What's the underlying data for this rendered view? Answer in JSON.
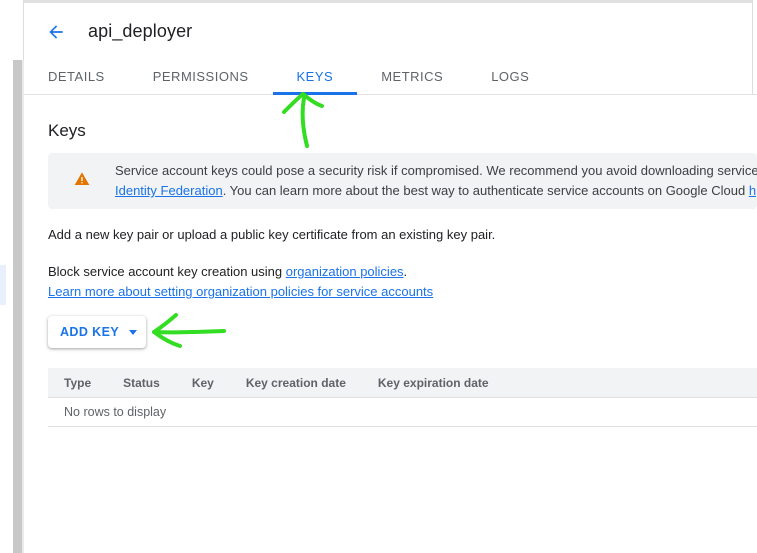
{
  "header": {
    "title": "api_deployer",
    "back_icon": "arrow-back-icon"
  },
  "tabs": [
    {
      "label": "DETAILS",
      "active": false
    },
    {
      "label": "PERMISSIONS",
      "active": false
    },
    {
      "label": "KEYS",
      "active": true
    },
    {
      "label": "METRICS",
      "active": false
    },
    {
      "label": "LOGS",
      "active": false
    }
  ],
  "section": {
    "title": "Keys"
  },
  "warning": {
    "icon": "warning-icon",
    "text_1": "Service account keys could pose a security risk if compromised. We recommend you avoid downloading service",
    "link_1": "Identity Federation",
    "text_2": ". You can learn more about the best way to authenticate service accounts on Google Cloud",
    "link_2": "h"
  },
  "body": {
    "intro": "Add a new key pair or upload a public key certificate from an existing key pair.",
    "block_text": "Block service account key creation using",
    "block_link": "organization policies",
    "block_period": ".",
    "learn_link": "Learn more about setting organization policies for service accounts"
  },
  "add_key": {
    "label": "ADD KEY",
    "icon": "caret-down-icon"
  },
  "table": {
    "columns": [
      "Type",
      "Status",
      "Key",
      "Key creation date",
      "Key expiration date"
    ],
    "empty_message": "No rows to display"
  },
  "colors": {
    "accent": "#1a73e8",
    "warning": "#e37400",
    "annotation": "#33dd22"
  }
}
